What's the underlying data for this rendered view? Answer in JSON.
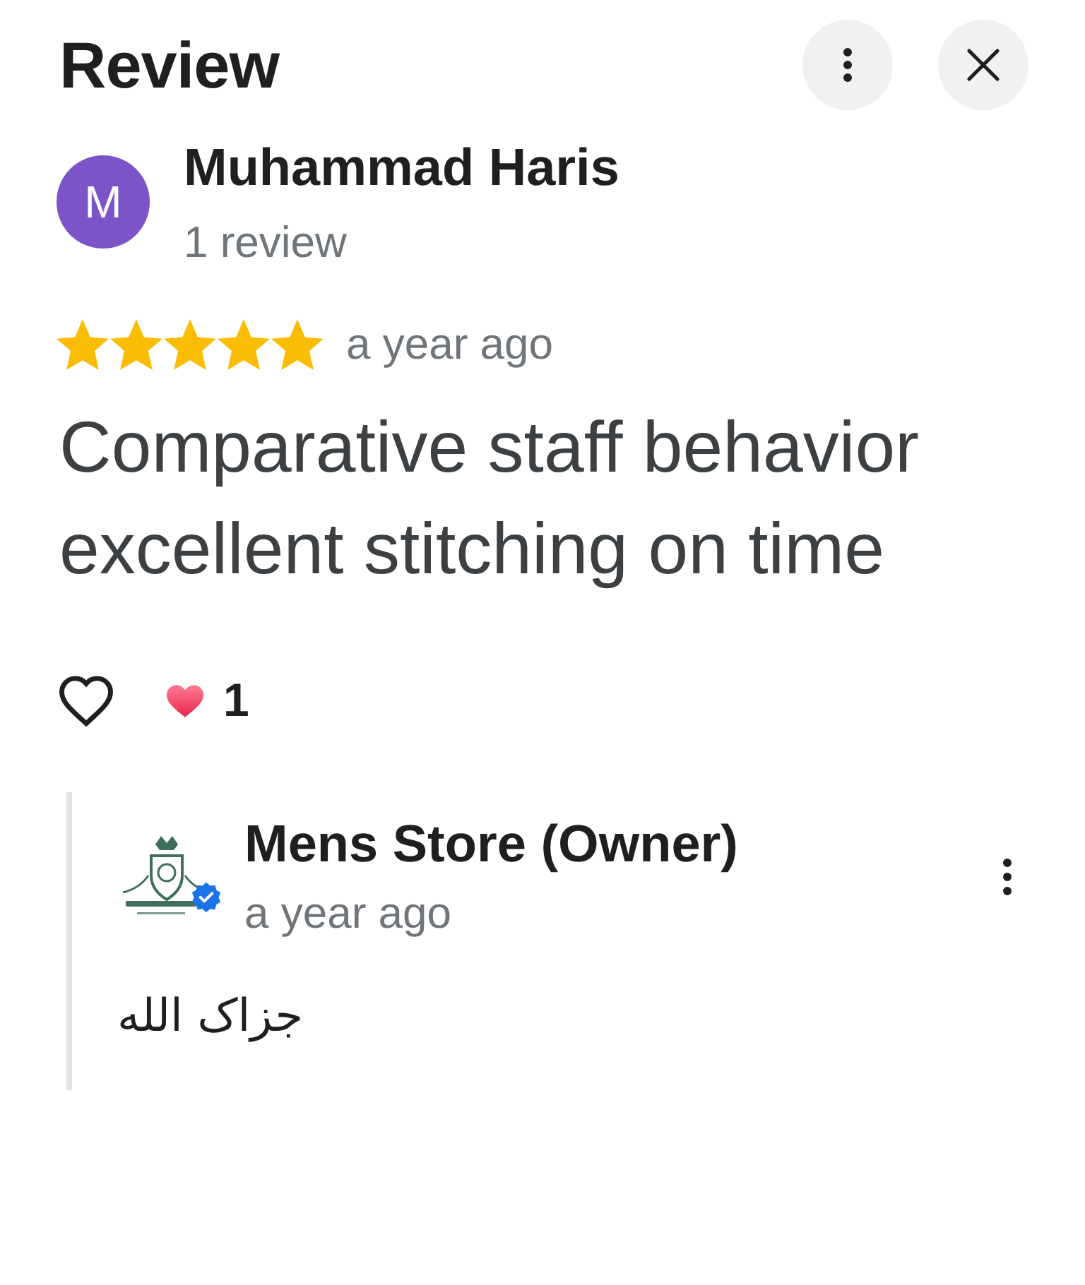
{
  "header": {
    "title": "Review"
  },
  "reviewer": {
    "avatar_letter": "M",
    "name": "Muhammad Haris",
    "review_count": "1 review"
  },
  "rating": {
    "stars": 5,
    "time": "a year ago"
  },
  "review_text": "Comparative staff behavior excellent stitching on time",
  "reactions": {
    "liked": false,
    "count": "1"
  },
  "owner_reply": {
    "name": "Mens Store (Owner)",
    "verified": true,
    "time": "a year ago",
    "text": "جزاک الله"
  }
}
